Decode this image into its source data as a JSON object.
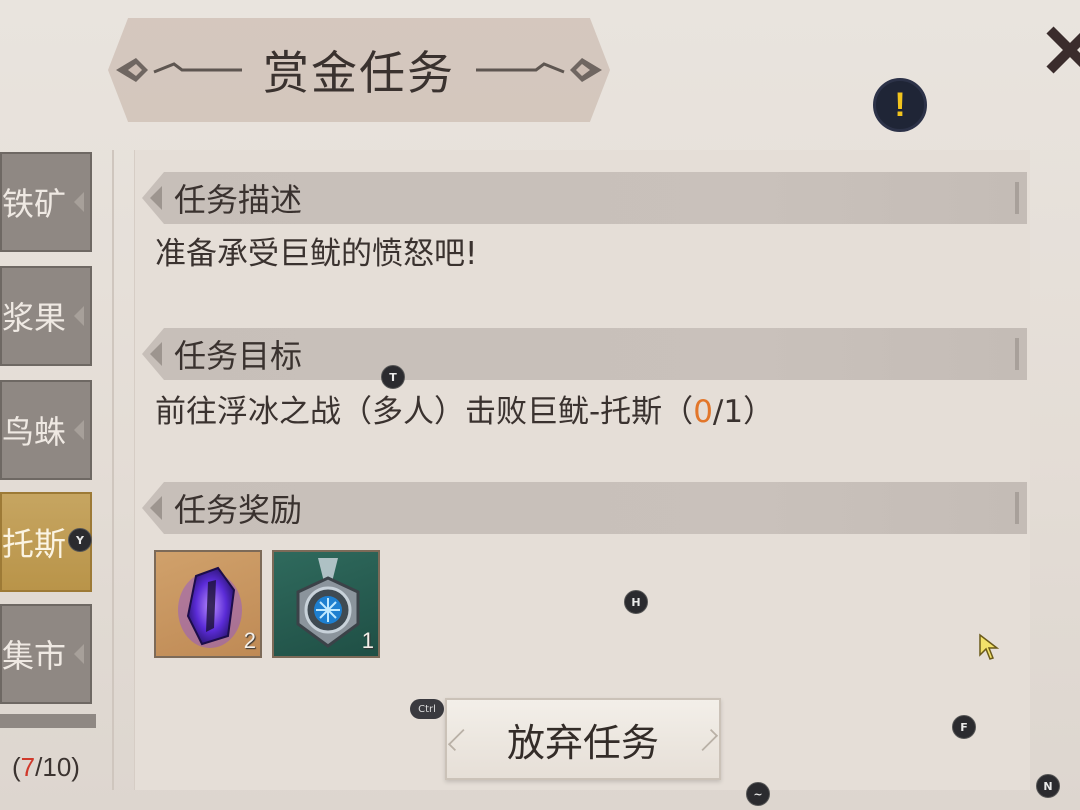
{
  "header": {
    "title": "赏金任务"
  },
  "alert_icon_glyph": "!",
  "sidebar": {
    "items": [
      {
        "label": "铁矿"
      },
      {
        "label": "浆果"
      },
      {
        "label": "鸟蛛"
      },
      {
        "label": "托斯",
        "active": true,
        "key": "Y"
      },
      {
        "label": "集市"
      }
    ],
    "progress": {
      "open": "(",
      "current": "7",
      "sep_total": "/10)"
    }
  },
  "description": {
    "header": "任务描述",
    "text": "准备承受巨鱿的愤怒吧!"
  },
  "objective": {
    "header": "任务目标",
    "text": "前往浮冰之战（多人）击败巨鱿-托斯（",
    "current": "0",
    "rest": "/1）"
  },
  "rewards": {
    "header": "任务奖励",
    "items": [
      {
        "icon": "purple-crystal-icon",
        "quantity": "2"
      },
      {
        "icon": "medal-icon",
        "quantity": "1"
      }
    ]
  },
  "abandon_button": {
    "label": "放弃任务"
  },
  "key_hints": {
    "t": "T",
    "h": "H",
    "ctrl": "Ctrl",
    "f": "F",
    "n": "N",
    "tilde": "~"
  },
  "colors": {
    "accent_orange": "#e2762a",
    "progress_red": "#d0392b",
    "active_tab_gold": "#c6a561",
    "alert_yellow": "#f2c41d"
  }
}
